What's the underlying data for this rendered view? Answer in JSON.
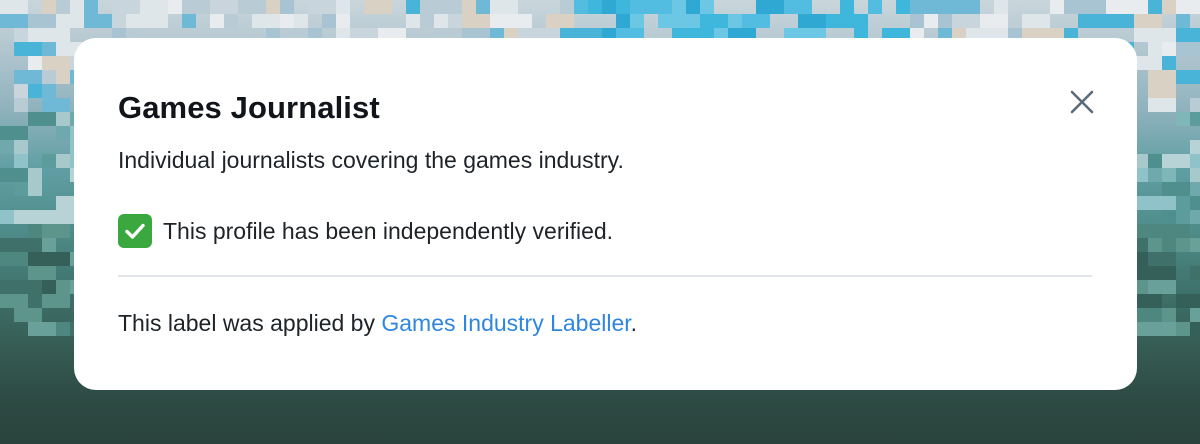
{
  "dialog": {
    "title": "Games Journalist",
    "description": "Individual journalists covering the games industry.",
    "verified_text": "This profile has been independently verified.",
    "applied_prefix": "This label was applied by ",
    "labeller_name": "Games Industry Labeller",
    "applied_suffix": "."
  },
  "icons": {
    "close": "close-icon",
    "verified": "check-mark-icon"
  },
  "colors": {
    "link": "#2f86e0",
    "check_background": "#3aa83e",
    "dialog_background": "#ffffff"
  }
}
